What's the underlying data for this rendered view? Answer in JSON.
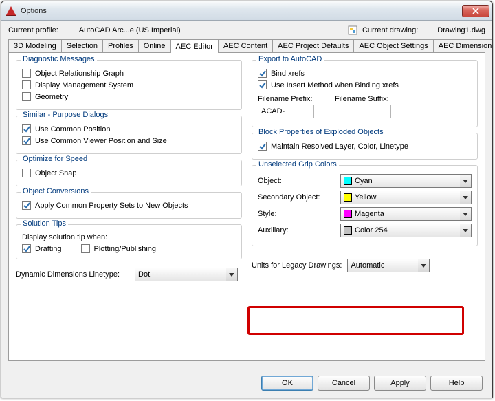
{
  "window": {
    "title": "Options"
  },
  "header": {
    "profile_label": "Current profile:",
    "profile_value": "AutoCAD Arc...e (US Imperial)",
    "drawing_label": "Current drawing:",
    "drawing_value": "Drawing1.dwg"
  },
  "tabs": {
    "t0": "3D Modeling",
    "t1": "Selection",
    "t2": "Profiles",
    "t3": "Online",
    "t4": "AEC Editor",
    "t5": "AEC Content",
    "t6": "AEC Project Defaults",
    "t7": "AEC Object Settings",
    "t8": "AEC Dimension"
  },
  "left": {
    "diag": {
      "title": "Diagnostic Messages",
      "c0": "Object Relationship Graph",
      "c1": "Display Management System",
      "c2": "Geometry"
    },
    "sim": {
      "title": "Similar - Purpose Dialogs",
      "c0": "Use Common Position",
      "c1": "Use Common Viewer Position and Size"
    },
    "opt": {
      "title": "Optimize for Speed",
      "c0": "Object Snap"
    },
    "conv": {
      "title": "Object Conversions",
      "c0": "Apply Common Property Sets to New Objects"
    },
    "sol": {
      "title": "Solution Tips",
      "sub": "Display solution tip when:",
      "c0": "Drafting",
      "c1": "Plotting/Publishing"
    },
    "ddl_label": "Dynamic Dimensions Linetype:",
    "ddl_value": "Dot"
  },
  "right": {
    "exp": {
      "title": "Export to AutoCAD",
      "c0": "Bind xrefs",
      "c1": "Use Insert Method when Binding xrefs",
      "pfx_label": "Filename Prefix:",
      "pfx_value": "ACAD-",
      "sfx_label": "Filename Suffix:",
      "sfx_value": ""
    },
    "blk": {
      "title": "Block Properties of Exploded Objects",
      "c0": "Maintain Resolved Layer, Color, Linetype"
    },
    "grip": {
      "title": "Unselected Grip Colors",
      "r0l": "Object:",
      "r0v": "Cyan",
      "r0c": "#00FFFF",
      "r1l": "Secondary Object:",
      "r1v": "Yellow",
      "r1c": "#FFFF00",
      "r2l": "Style:",
      "r2v": "Magenta",
      "r2c": "#FF00FF",
      "r3l": "Auxiliary:",
      "r3v": "Color 254",
      "r3c": "#C0C0C0"
    },
    "legacy": {
      "label": "Units for Legacy Drawings:",
      "value": "Automatic"
    }
  },
  "buttons": {
    "ok": "OK",
    "cancel": "Cancel",
    "apply": "Apply",
    "help": "Help"
  }
}
